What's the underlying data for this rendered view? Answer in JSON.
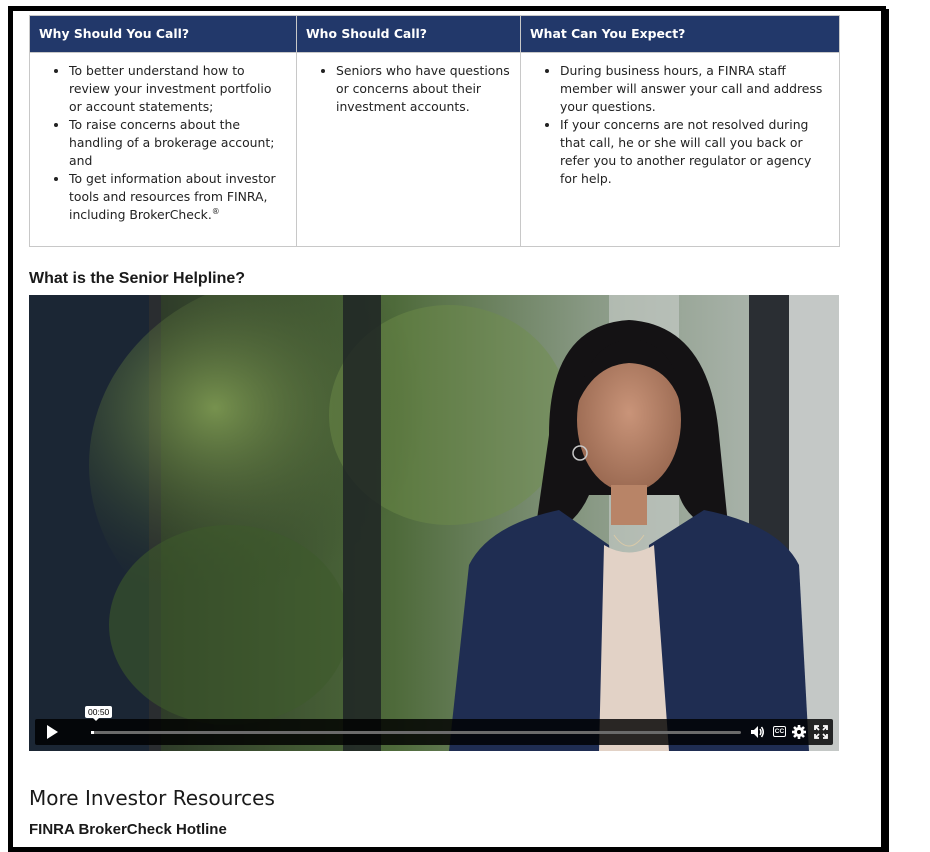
{
  "table": {
    "headers": [
      "Why Should You Call?",
      "Who Should Call?",
      "What Can You Expect?"
    ],
    "why": [
      "To better understand how to review your investment portfolio or account statements;",
      "To raise concerns about the handling of a brokerage account; and",
      "To get information about investor tools and resources from FINRA, including BrokerCheck."
    ],
    "why_sup": "®",
    "who": [
      "Seniors who have questions or concerns about their investment accounts."
    ],
    "expect": [
      "During business hours, a FINRA staff member will answer your call and address your questions.",
      "If your concerns are not resolved during that call, he or she will call you back or refer you to another regulator or agency for help."
    ]
  },
  "video_section": {
    "title": "What is the Senior Helpline?"
  },
  "video": {
    "time_tooltip": "00:50",
    "progress_percent": 0.5,
    "cc_label": "CC",
    "icons": [
      "play-icon",
      "volume-icon",
      "captions-icon",
      "settings-icon",
      "fullscreen-icon"
    ]
  },
  "resources": {
    "title": "More Investor Resources",
    "hotline": "FINRA BrokerCheck Hotline"
  },
  "colors": {
    "header_bg": "#22386a",
    "border": "#c8c8c8"
  }
}
